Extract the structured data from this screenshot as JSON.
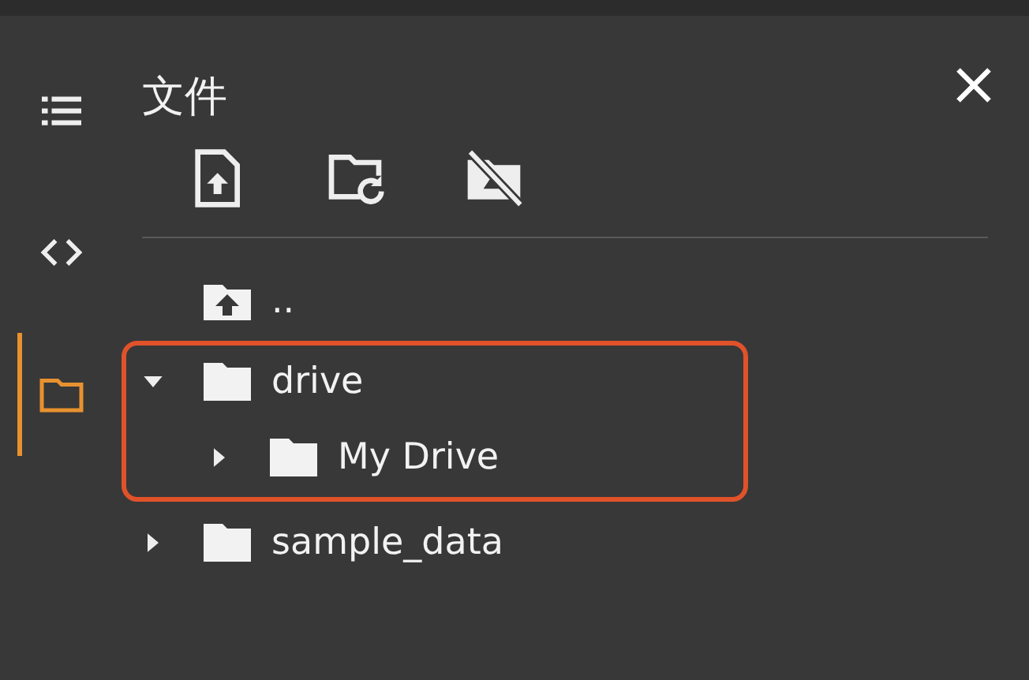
{
  "sidebar": {
    "items": [
      {
        "kind": "list",
        "selected": false
      },
      {
        "kind": "code",
        "selected": false
      },
      {
        "kind": "folder",
        "selected": true
      }
    ]
  },
  "panel": {
    "title": "文件"
  },
  "toolbar": {
    "buttons": [
      {
        "kind": "upload"
      },
      {
        "kind": "refresh"
      },
      {
        "kind": "unmount"
      }
    ]
  },
  "tree": [
    {
      "name": "..",
      "kind": "parent"
    },
    {
      "name": "drive",
      "kind": "folder",
      "expanded": true,
      "highlighted": true,
      "children": [
        {
          "name": "My Drive",
          "kind": "folder",
          "expanded": false,
          "highlighted": false
        }
      ]
    },
    {
      "name": "sample_data",
      "kind": "folder",
      "expanded": false,
      "highlighted": false
    }
  ]
}
